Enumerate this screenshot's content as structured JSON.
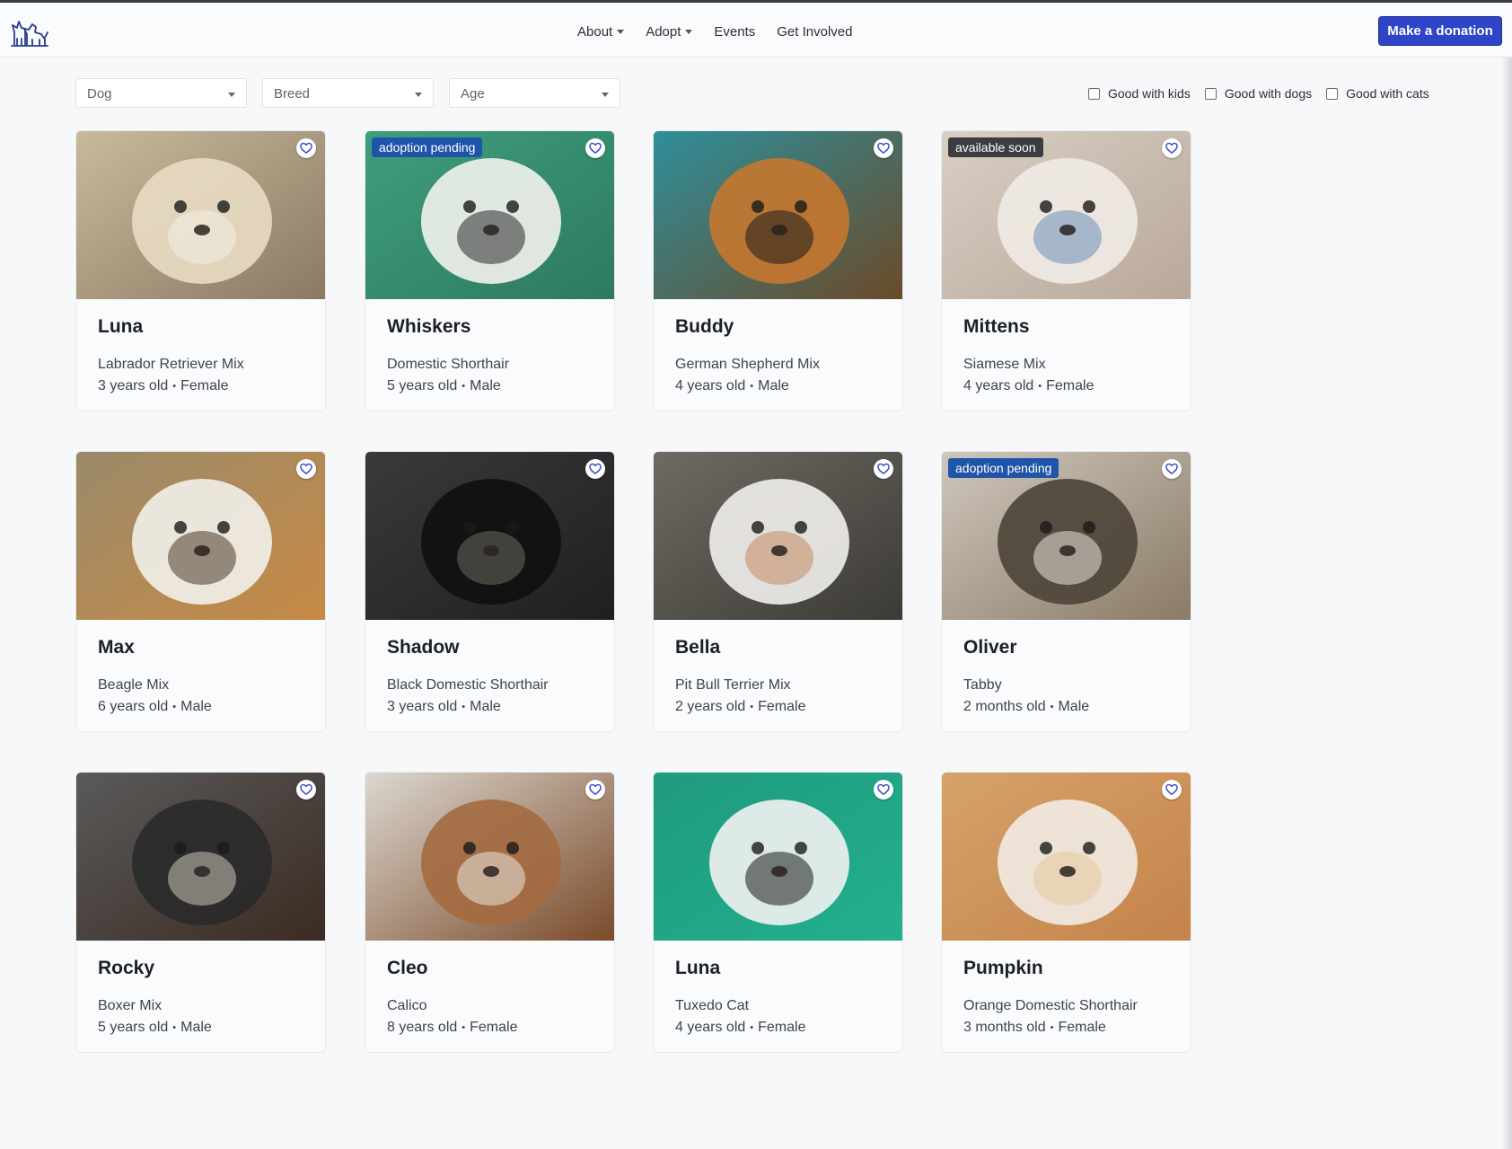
{
  "nav": {
    "links": [
      {
        "label": "About",
        "dropdown": true
      },
      {
        "label": "Adopt",
        "dropdown": true
      },
      {
        "label": "Events",
        "dropdown": false
      },
      {
        "label": "Get Involved",
        "dropdown": false
      }
    ],
    "donate_label": "Make a donation",
    "logo_icon": "dog-and-cat-logo-icon"
  },
  "filters": {
    "species": "Dog",
    "breed": "Breed",
    "age": "Age",
    "checkboxes": [
      {
        "label": "Good with kids",
        "checked": false
      },
      {
        "label": "Good with dogs",
        "checked": false
      },
      {
        "label": "Good with cats",
        "checked": false
      }
    ]
  },
  "colors": {
    "accent": "#2f45c7",
    "badge_pending": "#1f55a8",
    "badge_soon": "#3b3d40"
  },
  "pets": [
    {
      "name": "Luna",
      "breed": "Labrador Retriever Mix",
      "age": "3 years old",
      "sex": "Female",
      "badge": ""
    },
    {
      "name": "Whiskers",
      "breed": "Domestic Shorthair",
      "age": "5 years old",
      "sex": "Male",
      "badge": "adoption pending"
    },
    {
      "name": "Buddy",
      "breed": "German Shepherd Mix",
      "age": "4 years old",
      "sex": "Male",
      "badge": ""
    },
    {
      "name": "Mittens",
      "breed": "Siamese Mix",
      "age": "4 years old",
      "sex": "Female",
      "badge": "available soon"
    },
    {
      "name": "Max",
      "breed": "Beagle Mix",
      "age": "6 years old",
      "sex": "Male",
      "badge": ""
    },
    {
      "name": "Shadow",
      "breed": "Black Domestic Shorthair",
      "age": "3 years old",
      "sex": "Male",
      "badge": ""
    },
    {
      "name": "Bella",
      "breed": "Pit Bull Terrier Mix",
      "age": "2 years old",
      "sex": "Female",
      "badge": ""
    },
    {
      "name": "Oliver",
      "breed": "Tabby",
      "age": "2 months old",
      "sex": "Male",
      "badge": "adoption pending"
    },
    {
      "name": "Rocky",
      "breed": "Boxer Mix",
      "age": "5 years old",
      "sex": "Male",
      "badge": ""
    },
    {
      "name": "Cleo",
      "breed": "Calico",
      "age": "8 years old",
      "sex": "Female",
      "badge": ""
    },
    {
      "name": "Luna",
      "breed": "Tuxedo Cat",
      "age": "4 years old",
      "sex": "Female",
      "badge": ""
    },
    {
      "name": "Pumpkin",
      "breed": "Orange Domestic Shorthair",
      "age": "3 months old",
      "sex": "Female",
      "badge": ""
    }
  ]
}
